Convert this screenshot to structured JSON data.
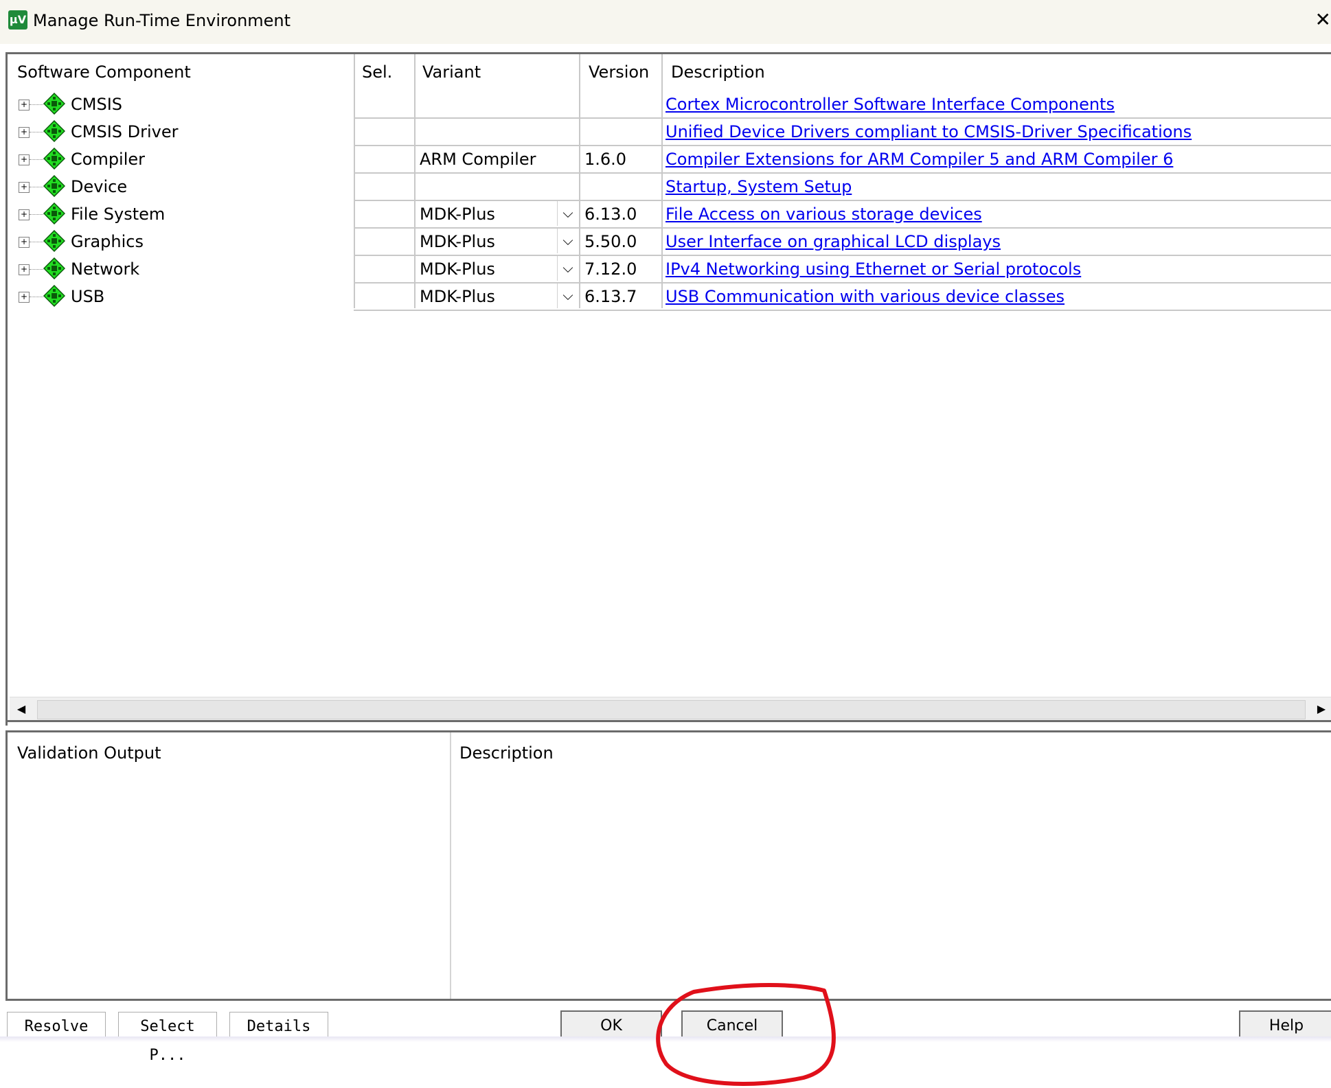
{
  "window": {
    "title": "Manage Run-Time Environment",
    "app_icon_text": "µV",
    "close_icon": "close-icon"
  },
  "grid": {
    "headers": {
      "component": "Software Component",
      "sel": "Sel.",
      "variant": "Variant",
      "version": "Version",
      "description": "Description"
    },
    "rows": [
      {
        "name": "CMSIS",
        "variant": "",
        "version": "",
        "description": "Cortex Microcontroller Software Interface Components"
      },
      {
        "name": "CMSIS Driver",
        "variant": "",
        "version": "",
        "description": "Unified Device Drivers compliant to CMSIS-Driver Specifications"
      },
      {
        "name": "Compiler",
        "variant": "ARM Compiler",
        "version": "1.6.0",
        "description": "Compiler Extensions for ARM Compiler 5 and ARM Compiler 6"
      },
      {
        "name": "Device",
        "variant": "",
        "version": "",
        "description": "Startup, System Setup"
      },
      {
        "name": "File System",
        "variant": "MDK-Plus",
        "version": "6.13.0",
        "description": "File Access on various storage devices"
      },
      {
        "name": "Graphics",
        "variant": "MDK-Plus",
        "version": "5.50.0",
        "description": "User Interface on graphical LCD displays"
      },
      {
        "name": "Network",
        "variant": "MDK-Plus",
        "version": "7.12.0",
        "description": "IPv4 Networking using Ethernet or Serial protocols"
      },
      {
        "name": "USB",
        "variant": "MDK-Plus",
        "version": "6.13.7",
        "description": "USB Communication with various device classes"
      }
    ]
  },
  "validation": {
    "output_header": "Validation Output",
    "description_header": "Description"
  },
  "buttons": {
    "resolve": "Resolve",
    "select_packs": "Select P...",
    "details": "Details",
    "ok": "OK",
    "cancel": "Cancel",
    "help": "Help"
  },
  "colors": {
    "link": "#0000ee",
    "component_icon": "#22dd22",
    "annotation": "#e0101a"
  }
}
